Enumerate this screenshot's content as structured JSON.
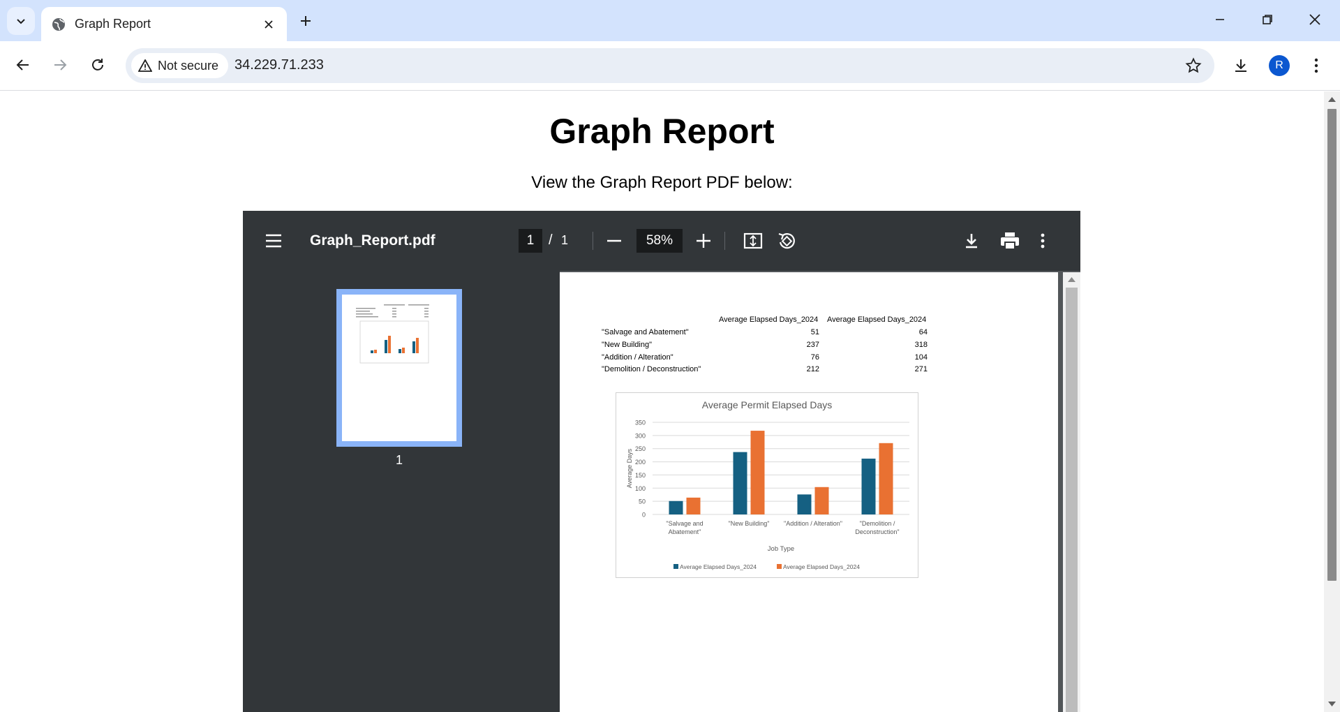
{
  "browser": {
    "tab_title": "Graph Report",
    "security_label": "Not secure",
    "url": "34.229.71.233",
    "avatar_letter": "R"
  },
  "page": {
    "title": "Graph Report",
    "subtitle": "View the Graph Report PDF below:"
  },
  "pdf_viewer": {
    "filename": "Graph_Report.pdf",
    "current_page": "1",
    "page_separator": "/",
    "total_pages": "1",
    "zoom": "58%",
    "thumbnail_label": "1"
  },
  "pdf_table": {
    "headers": [
      "Average Elapsed Days_2024",
      "Average Elapsed Days_2024"
    ],
    "rows": [
      {
        "label": "\"Salvage and Abatement\"",
        "v1": "51",
        "v2": "64"
      },
      {
        "label": "\"New Building\"",
        "v1": "237",
        "v2": "318"
      },
      {
        "label": "\"Addition / Alteration\"",
        "v1": "76",
        "v2": "104"
      },
      {
        "label": "\"Demolition / Deconstruction\"",
        "v1": "212",
        "v2": "271"
      }
    ]
  },
  "chart_data": {
    "type": "bar",
    "title": "Average Permit Elapsed Days",
    "xlabel": "Job Type",
    "ylabel": "Average Days",
    "ylim": [
      0,
      350
    ],
    "yticks": [
      0,
      50,
      100,
      150,
      200,
      250,
      300,
      350
    ],
    "grid": true,
    "legend": "bottom",
    "categories": [
      [
        "\"Salvage and",
        "Abatement\""
      ],
      [
        "\"New Building\""
      ],
      [
        "\"Addition / Alteration\""
      ],
      [
        "\"Demolition /",
        "Deconstruction\""
      ]
    ],
    "series": [
      {
        "name": "Average Elapsed Days_2024",
        "color": "#156082",
        "values": [
          51,
          237,
          76,
          212
        ]
      },
      {
        "name": "Average Elapsed Days_2024",
        "color": "#e97132",
        "values": [
          64,
          318,
          104,
          271
        ]
      }
    ]
  },
  "colors": {
    "tabstrip": "#d3e3fd",
    "pdf_toolbar": "#323639",
    "pdf_background": "#525659",
    "thumbnail_highlight": "#8ab4f8"
  }
}
